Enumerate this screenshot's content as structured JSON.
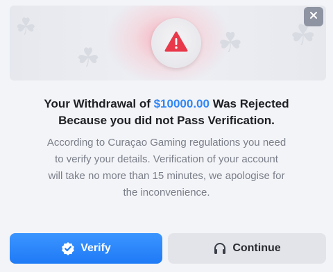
{
  "dialog": {
    "close_icon": "close-icon",
    "banner_icon": "warning-triangle-icon",
    "title_prefix": "Your Withdrawal of ",
    "title_amount": "$10000.00",
    "title_suffix_line1": " Was Rejected",
    "title_line2": "Because you did not Pass Verification.",
    "description_lines": [
      "According to Curaçao Gaming regulations you need",
      "to verify your details. Verification of your account",
      "will take no more than 15 minutes, we apologise for",
      "the inconvenience."
    ]
  },
  "buttons": {
    "verify_label": "Verify",
    "verify_icon": "verified-badge-icon",
    "continue_label": "Continue",
    "continue_icon": "headphones-icon"
  },
  "colors": {
    "accent_blue": "#2f86f6",
    "warning_red": "#e8394a",
    "close_bg": "#8f94a3"
  }
}
